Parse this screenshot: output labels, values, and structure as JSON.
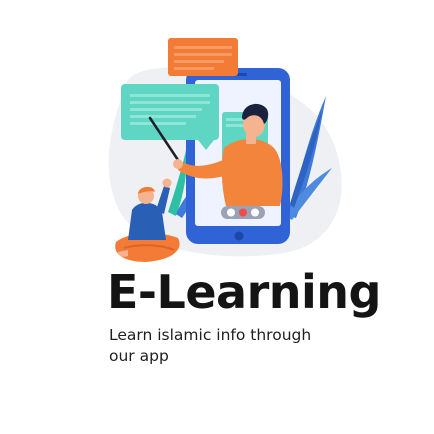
{
  "hero": {
    "illustration_icon": "e-learning-teacher-phone-illustration",
    "colors": {
      "phone": "#2f63d6",
      "chat_orange": "#f47b35",
      "chat_teal": "#5fd6c3",
      "teacher_shirt": "#f2843c",
      "student_shirt": "#2a5fb6",
      "skin": "#f5b48f",
      "blob": "#eef0f3",
      "leaves": "#3e7bd8"
    }
  },
  "content": {
    "title": "E-Learning",
    "subtitle": "Learn islamic info through our app"
  }
}
